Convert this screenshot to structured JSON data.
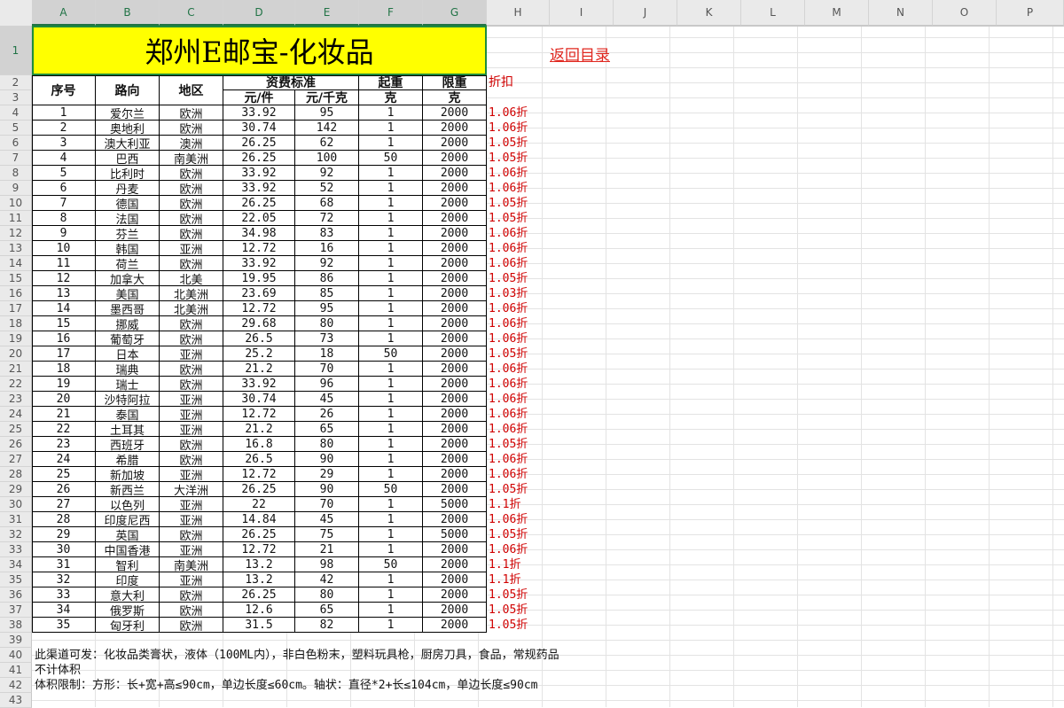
{
  "columns": [
    "A",
    "B",
    "C",
    "D",
    "E",
    "F",
    "G",
    "H",
    "I",
    "J",
    "K",
    "L",
    "M",
    "N",
    "O",
    "P"
  ],
  "row_numbers": [
    "1",
    "2",
    "3",
    "4",
    "5",
    "6",
    "7",
    "8",
    "9",
    "10",
    "11",
    "12",
    "13",
    "14",
    "15",
    "16",
    "17",
    "18",
    "19",
    "20",
    "21",
    "22",
    "23",
    "24",
    "25",
    "26",
    "27",
    "28",
    "29",
    "30",
    "31",
    "32",
    "33",
    "34",
    "35",
    "36",
    "37",
    "38",
    "39",
    "40",
    "41",
    "42",
    "43"
  ],
  "title": "郑州E邮宝-化妆品",
  "back_link": "返回目录",
  "headers": {
    "seq": "序号",
    "route": "路向",
    "region": "地区",
    "fee_standard": "资费标准",
    "per_item": "元/件",
    "per_kg": "元/千克",
    "start_weight": "起重",
    "start_weight_unit": "克",
    "limit_weight": "限重",
    "limit_weight_unit": "克",
    "discount": "折扣"
  },
  "rows": [
    [
      "1",
      "爱尔兰",
      "欧洲",
      "33.92",
      "95",
      "1",
      "2000",
      "1.06折"
    ],
    [
      "2",
      "奥地利",
      "欧洲",
      "30.74",
      "142",
      "1",
      "2000",
      "1.06折"
    ],
    [
      "3",
      "澳大利亚",
      "澳洲",
      "26.25",
      "62",
      "1",
      "2000",
      "1.05折"
    ],
    [
      "4",
      "巴西",
      "南美洲",
      "26.25",
      "100",
      "50",
      "2000",
      "1.05折"
    ],
    [
      "5",
      "比利时",
      "欧洲",
      "33.92",
      "92",
      "1",
      "2000",
      "1.06折"
    ],
    [
      "6",
      "丹麦",
      "欧洲",
      "33.92",
      "52",
      "1",
      "2000",
      "1.06折"
    ],
    [
      "7",
      "德国",
      "欧洲",
      "26.25",
      "68",
      "1",
      "2000",
      "1.05折"
    ],
    [
      "8",
      "法国",
      "欧洲",
      "22.05",
      "72",
      "1",
      "2000",
      "1.05折"
    ],
    [
      "9",
      "芬兰",
      "欧洲",
      "34.98",
      "83",
      "1",
      "2000",
      "1.06折"
    ],
    [
      "10",
      "韩国",
      "亚洲",
      "12.72",
      "16",
      "1",
      "2000",
      "1.06折"
    ],
    [
      "11",
      "荷兰",
      "欧洲",
      "33.92",
      "92",
      "1",
      "2000",
      "1.06折"
    ],
    [
      "12",
      "加拿大",
      "北美",
      "19.95",
      "86",
      "1",
      "2000",
      "1.05折"
    ],
    [
      "13",
      "美国",
      "北美洲",
      "23.69",
      "85",
      "1",
      "2000",
      "1.03折"
    ],
    [
      "14",
      "墨西哥",
      "北美洲",
      "12.72",
      "95",
      "1",
      "2000",
      "1.06折"
    ],
    [
      "15",
      "挪威",
      "欧洲",
      "29.68",
      "80",
      "1",
      "2000",
      "1.06折"
    ],
    [
      "16",
      "葡萄牙",
      "欧洲",
      "26.5",
      "73",
      "1",
      "2000",
      "1.06折"
    ],
    [
      "17",
      "日本",
      "亚洲",
      "25.2",
      "18",
      "50",
      "2000",
      "1.05折"
    ],
    [
      "18",
      "瑞典",
      "欧洲",
      "21.2",
      "70",
      "1",
      "2000",
      "1.06折"
    ],
    [
      "19",
      "瑞士",
      "欧洲",
      "33.92",
      "96",
      "1",
      "2000",
      "1.06折"
    ],
    [
      "20",
      "沙特阿拉",
      "亚洲",
      "30.74",
      "45",
      "1",
      "2000",
      "1.06折"
    ],
    [
      "21",
      "泰国",
      "亚洲",
      "12.72",
      "26",
      "1",
      "2000",
      "1.06折"
    ],
    [
      "22",
      "土耳其",
      "亚洲",
      "21.2",
      "65",
      "1",
      "2000",
      "1.06折"
    ],
    [
      "23",
      "西班牙",
      "欧洲",
      "16.8",
      "80",
      "1",
      "2000",
      "1.05折"
    ],
    [
      "24",
      "希腊",
      "欧洲",
      "26.5",
      "90",
      "1",
      "2000",
      "1.06折"
    ],
    [
      "25",
      "新加坡",
      "亚洲",
      "12.72",
      "29",
      "1",
      "2000",
      "1.06折"
    ],
    [
      "26",
      "新西兰",
      "大洋洲",
      "26.25",
      "90",
      "50",
      "2000",
      "1.05折"
    ],
    [
      "27",
      "以色列",
      "亚洲",
      "22",
      "70",
      "1",
      "5000",
      "1.1折"
    ],
    [
      "28",
      "印度尼西",
      "亚洲",
      "14.84",
      "45",
      "1",
      "2000",
      "1.06折"
    ],
    [
      "29",
      "英国",
      "欧洲",
      "26.25",
      "75",
      "1",
      "5000",
      "1.05折"
    ],
    [
      "30",
      "中国香港",
      "亚洲",
      "12.72",
      "21",
      "1",
      "2000",
      "1.06折"
    ],
    [
      "31",
      "智利",
      "南美洲",
      "13.2",
      "98",
      "50",
      "2000",
      "1.1折"
    ],
    [
      "32",
      "印度",
      "亚洲",
      "13.2",
      "42",
      "1",
      "2000",
      "1.1折"
    ],
    [
      "33",
      "意大利",
      "欧洲",
      "26.25",
      "80",
      "1",
      "2000",
      "1.05折"
    ],
    [
      "34",
      "俄罗斯",
      "欧洲",
      "12.6",
      "65",
      "1",
      "2000",
      "1.05折"
    ],
    [
      "35",
      "匈牙利",
      "欧洲",
      "31.5",
      "82",
      "1",
      "2000",
      "1.05折"
    ]
  ],
  "notes": [
    "此渠道可发：化妆品类膏状，液体（100ML内），非白色粉末，塑料玩具枪，厨房刀具，食品，常规药品",
    "不计体积",
    "体积限制：方形：长+宽+高≤90cm，单边长度≤60cm。轴状：直径*2+长≤104cm，单边长度≤90cm"
  ],
  "colors": {
    "title_bg": "#ffff00",
    "title_border": "#1e8c3c",
    "discount_text": "#d00000",
    "link_text": "#e0271f"
  }
}
